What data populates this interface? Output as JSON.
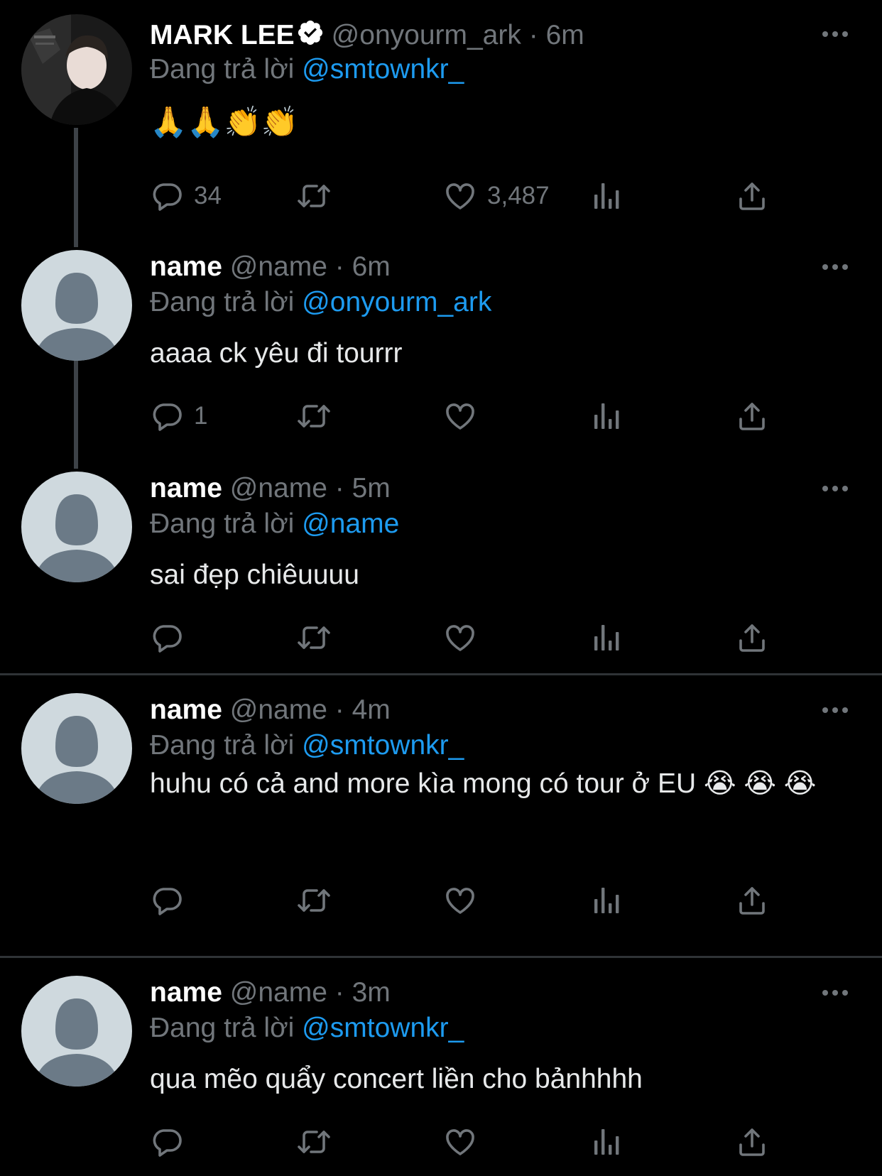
{
  "tweets": [
    {
      "name": "MARK LEE",
      "verified": true,
      "handle": "@onyourm_ark",
      "separator": "·",
      "time": "6m",
      "reply_prefix": "Đang trả lời",
      "reply_to": "@smtownkr_",
      "text": "🙏🙏👏👏",
      "reply_count": "34",
      "retweet_count": "",
      "like_count": "3,487"
    },
    {
      "name": "name",
      "handle": "@name",
      "separator": "·",
      "time": "6m",
      "reply_prefix": "Đang trả lời",
      "reply_to": "@onyourm_ark",
      "text": "aaaa ck yêu đi tourrr",
      "reply_count": "1",
      "retweet_count": "",
      "like_count": ""
    },
    {
      "name": "name",
      "handle": "@name",
      "separator": "·",
      "time": "5m",
      "reply_prefix": "Đang trả lời",
      "reply_to": "@name",
      "text": "sai đẹp chiêuuuu",
      "reply_count": "",
      "retweet_count": "",
      "like_count": ""
    },
    {
      "name": "name",
      "handle": "@name",
      "separator": "·",
      "time": "4m",
      "reply_prefix": "Đang trả lời",
      "reply_to": "@smtownkr_",
      "text": "huhu có cả and more kìa mong có tour ở EU 😭 😭 😭",
      "reply_count": "",
      "retweet_count": "",
      "like_count": ""
    },
    {
      "name": "name",
      "handle": "@name",
      "separator": "·",
      "time": "3m",
      "reply_prefix": "Đang trả lời",
      "reply_to": "@smtownkr_",
      "text": "qua mẽo quẩy concert liền cho bảnhhhh",
      "reply_count": "",
      "retweet_count": "",
      "like_count": ""
    }
  ],
  "colors": {
    "background": "#000000",
    "text_primary": "#e7e9ea",
    "text_secondary": "#71767b",
    "mention": "#1d9bf0",
    "thread_line": "#3d4247",
    "avatar_bg": "#cfd9de",
    "avatar_fg": "#6b7a87"
  },
  "icons": [
    "reply-icon",
    "retweet-icon",
    "like-icon",
    "analytics-icon",
    "share-icon",
    "more-icon",
    "verified-icon"
  ]
}
